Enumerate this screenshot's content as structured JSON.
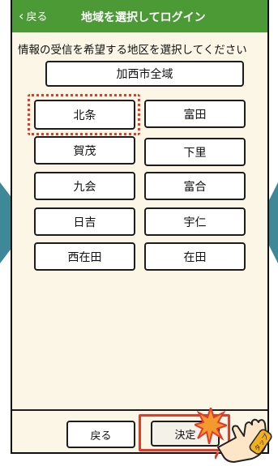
{
  "header": {
    "back_label": "戻る",
    "title": "地域を選択してログイン"
  },
  "prompt": "情報の受信を希望する地区を選択してください",
  "all_region_button": "加西市全域",
  "districts": [
    {
      "label": "北条",
      "selected": true
    },
    {
      "label": "富田",
      "selected": false
    },
    {
      "label": "賀茂",
      "selected": false
    },
    {
      "label": "下里",
      "selected": false
    },
    {
      "label": "九会",
      "selected": false
    },
    {
      "label": "富合",
      "selected": false
    },
    {
      "label": "日吉",
      "selected": false
    },
    {
      "label": "宇仁",
      "selected": false
    },
    {
      "label": "西在田",
      "selected": false
    },
    {
      "label": "在田",
      "selected": false
    }
  ],
  "footer": {
    "back_button": "戻る",
    "ok_button": "決定"
  },
  "annotations": {
    "tap_sticker": "タップ"
  },
  "colors": {
    "header_bg": "#4b9a35",
    "body_bg": "#fbf6e6",
    "highlight_red": "#e23b2a",
    "nav_arrow": "#3f8898"
  }
}
